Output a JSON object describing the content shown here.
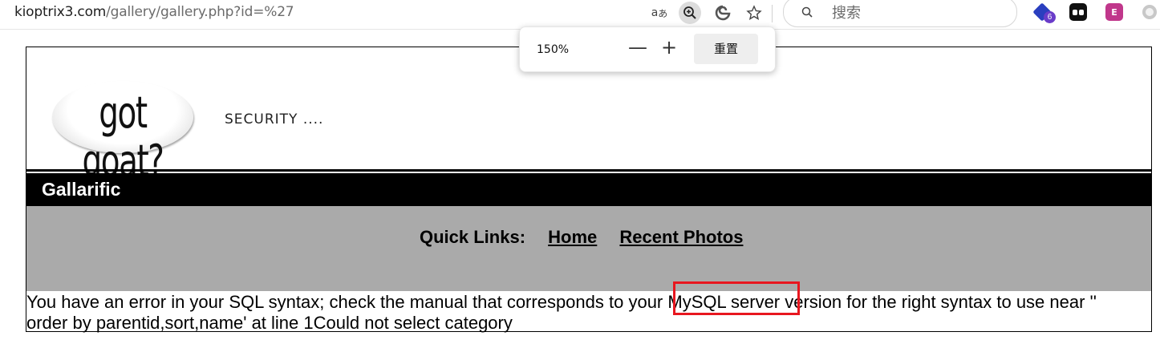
{
  "browser": {
    "url_host": "kioptrix3.com",
    "url_path": "/gallery/gallery.php?id=%27",
    "read_aloud_icon": "read-aloud-icon",
    "search_placeholder": "搜索",
    "extension_badge_count": "6",
    "extension3_label": "E"
  },
  "zoom_popup": {
    "level": "150%",
    "minus_label": "—",
    "plus_label": "+",
    "reset_label": "重置"
  },
  "page": {
    "logo_text": "got goat?",
    "tagline": "SECURITY ....",
    "site_title": "Gallarific",
    "quick_links_label": "Quick Links:",
    "links": [
      {
        "label": "Home"
      },
      {
        "label": "Recent Photos"
      }
    ],
    "error_message": "You have an error in your SQL syntax; check the manual that corresponds to your MySQL server version for the right syntax to use near '' order by parentid,sort,name' at line 1Could not select category",
    "highlight_color": "#e8171f"
  }
}
